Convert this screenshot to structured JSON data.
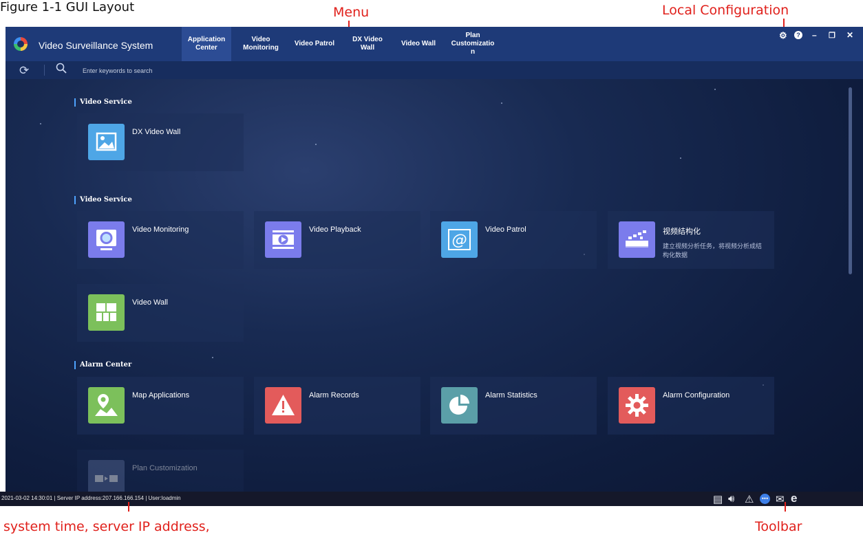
{
  "figure_caption": "Figure 1-1 GUI Layout",
  "annotations": {
    "menu": "Menu",
    "local_configuration": "Local Configuration",
    "system_info": "system time, server IP address,",
    "toolbar": "Toolbar"
  },
  "app": {
    "title": "Video Surveillance System"
  },
  "menu": [
    {
      "label": "Application\nCenter",
      "active": true
    },
    {
      "label": "Video\nMonitoring"
    },
    {
      "label": "Video Patrol"
    },
    {
      "label": "DX Video\nWall"
    },
    {
      "label": "Video Wall"
    },
    {
      "label": "Plan\nCustomizatio\nn"
    }
  ],
  "window_controls": [
    "gear-icon",
    "help-icon",
    "minimize-icon",
    "restore-icon",
    "close-icon"
  ],
  "search": {
    "placeholder": "Enter keywords to search"
  },
  "sections": [
    {
      "title": "Video Service"
    },
    {
      "title": "Video Service"
    },
    {
      "title": "Alarm Center"
    }
  ],
  "cards": [
    {
      "name": "DX Video Wall",
      "icon": "picture-icon",
      "color": "#4ea6e6"
    },
    {
      "name": "Video Monitoring",
      "icon": "camera-icon",
      "color": "#7b7cec"
    },
    {
      "name": "Video Playback",
      "icon": "play-icon",
      "color": "#7b7cec"
    },
    {
      "name": "Video Patrol",
      "icon": "at-icon",
      "color": "#4ea6e6"
    },
    {
      "name": "视频结构化",
      "desc": "建立视频分析任务，将视频分析成结构化数据",
      "icon": "structure-icon",
      "color": "#7b7cec"
    },
    {
      "name": "Video Wall",
      "icon": "grid-icon",
      "color": "#7cc05b"
    },
    {
      "name": "Map Applications",
      "icon": "map-icon",
      "color": "#7cc05b"
    },
    {
      "name": "Alarm Records",
      "icon": "warning-icon",
      "color": "#e35b5b"
    },
    {
      "name": "Alarm Statistics",
      "icon": "pie-icon",
      "color": "#5b9fa8"
    },
    {
      "name": "Alarm Configuration",
      "icon": "gear-icon",
      "color": "#e35b5b"
    },
    {
      "name": "Plan Customization",
      "icon": "plan-icon",
      "color": "#5a6c9a"
    }
  ],
  "status": {
    "text": "2021-03-02 14:30:01 | Server IP address:207.166.166.154 | User:loadmin"
  },
  "toolbar_icons": [
    "notes-icon",
    "volume-icon",
    "alarm-icon",
    "chat-icon",
    "mail-icon",
    "browser-icon"
  ]
}
